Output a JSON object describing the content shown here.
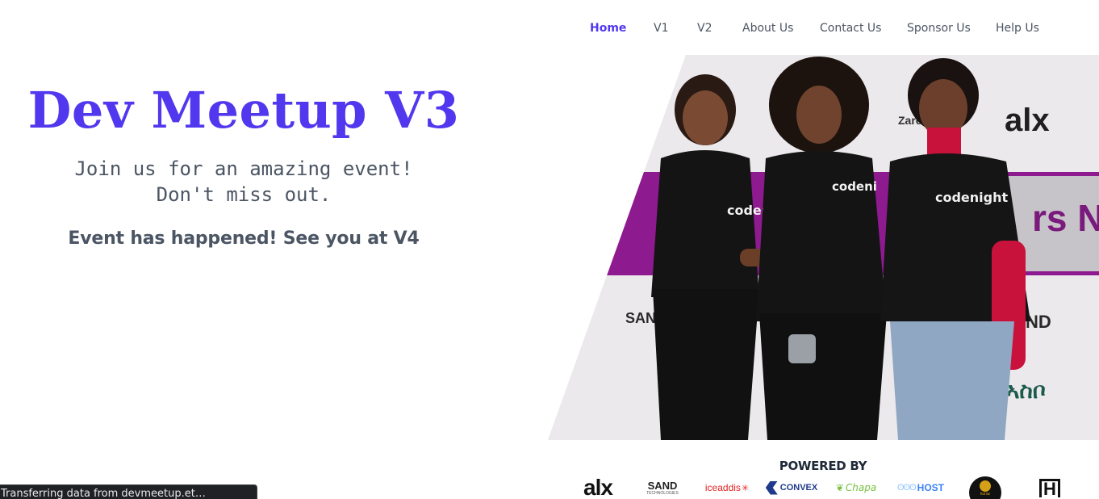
{
  "nav": {
    "items": [
      {
        "label": "Home",
        "active": true
      },
      {
        "label": "V1"
      },
      {
        "label": "V2"
      },
      {
        "label": "About Us"
      },
      {
        "label": "Contact Us"
      },
      {
        "label": "Sponsor Us"
      },
      {
        "label": "Help Us"
      }
    ]
  },
  "hero": {
    "title": "Dev Meetup V3",
    "tagline_line1": "Join us for an amazing event!",
    "tagline_line2": "Don't miss out.",
    "status": "Event has happened! See you at V4",
    "photo_texts": {
      "shirt_left": "coden",
      "shirt_mid": "codeni",
      "shirt_right": "codenight",
      "backdrop_alx": "alx",
      "backdrop_zare": "Zare",
      "backdrop_rs": "rs N",
      "backdrop_sand": "SAND",
      "backdrop_nd": "ND",
      "backdrop_logo": "ኣስቦ"
    }
  },
  "sponsors": {
    "heading": "POWERED BY",
    "logos": [
      {
        "name": "alx",
        "text": "alx"
      },
      {
        "name": "sand",
        "text": "SAND",
        "sub": "TECHNOLOGIES"
      },
      {
        "name": "iceaddis",
        "text": "iceaddis"
      },
      {
        "name": "convex",
        "text": "CONVEX"
      },
      {
        "name": "chapa",
        "text": "Chapa"
      },
      {
        "name": "host",
        "text": "HOST"
      },
      {
        "name": "kuraz",
        "text": "kuraz"
      },
      {
        "name": "h-logo",
        "text": "H"
      }
    ],
    "colors": {
      "brand": "#5138ee",
      "iceaddis": "#e02424",
      "convex": "#1f3a8a",
      "chapa": "#7ac143",
      "host": "#3b82f6"
    }
  },
  "browser_status": "Transferring data from devmeetup.et…"
}
